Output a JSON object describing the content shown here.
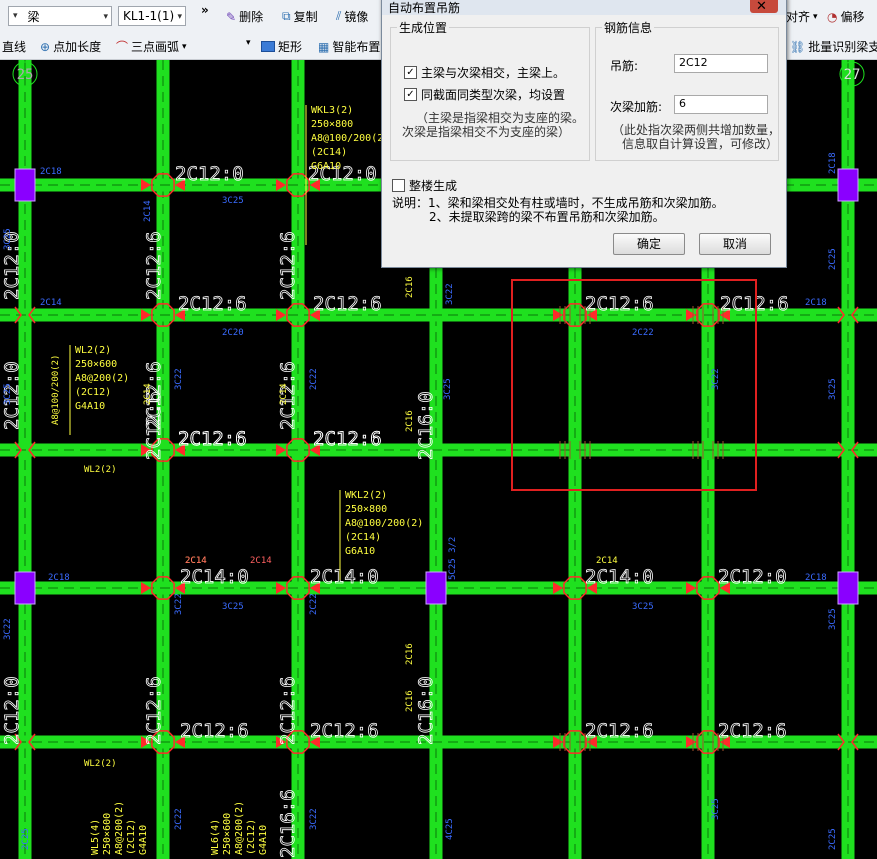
{
  "toolbar": {
    "component_type": "梁",
    "component_name": "KL1-1(1)",
    "more": "»",
    "delete": "删除",
    "copy": "复制",
    "mirror": "镜像",
    "align": "对齐",
    "offset": "偏移",
    "line": "直线",
    "point_length": "点加长度",
    "arc": "三点画弧",
    "rect": "矩形",
    "smart_layout": "智能布置",
    "batch_identify": "批量识别梁支"
  },
  "dialog": {
    "title": "自动布置吊筋",
    "close": "✕",
    "gen_position": {
      "legend": "生成位置",
      "opt1": "主梁与次梁相交，主梁上。",
      "opt2": "同截面同类型次梁，均设置",
      "note1": "（主梁是指梁相交为支座的梁。",
      "note2": "次梁是指梁相交不为支座的梁）"
    },
    "rebar_info": {
      "legend": "钢筋信息",
      "hanger_label": "吊筋:",
      "hanger_value": "2C12",
      "stirrup_label": "次梁加筋:",
      "stirrup_value": "6",
      "note1": "（此处指次梁两侧共增加数量，",
      "note2": "信息取自计算设置，可修改）"
    },
    "whole_floor": "整楼生成",
    "desc1": "说明：1、梁和梁相交处有柱或墙时，不生成吊筋和次梁加筋。",
    "desc2": "2、未提取梁跨的梁不布置吊筋和次梁加筋。",
    "ok": "确定",
    "cancel": "取消"
  },
  "cad": {
    "axis_left": "25",
    "axis_right": "27",
    "beam_labels": [
      "2C12:0",
      "2C12:0",
      "2C12:6",
      "2C12:6",
      "2C12:6",
      "2C12:6",
      "2C12:6",
      "2C12:6",
      "2C12:6",
      "2C12:6",
      "2C14:0",
      "2C14:0",
      "2C14:0",
      "2C12:0",
      "2C12:6",
      "2C12:6",
      "2C12:6",
      "2C12:6"
    ],
    "vertical_labels": [
      "2C12:0",
      "2C12:6",
      "2C12:6",
      "2C12:0",
      "2C12:6",
      "2C12:6",
      "2C12:6",
      "2C16:0",
      "2C12:0",
      "2C12:6",
      "2C12:6",
      "2C16:0",
      "2C16:6"
    ],
    "blue_labels": [
      "2C18",
      "3C25",
      "2C14",
      "2C18",
      "3C25",
      "2C14",
      "2C20",
      "3C22",
      "2C22",
      "3C25",
      "3C22",
      "2C22",
      "3C25",
      "2C18",
      "3C25",
      "3C22",
      "5C25 3/2",
      "3C25",
      "3C22",
      "2C22",
      "3C25",
      "2C25",
      "3C22",
      "3C25",
      "2C18",
      "4C25",
      "2C25",
      "2C22",
      "3C22",
      "3C25",
      "2C25",
      "2C18"
    ],
    "yellow_blocks": [
      [
        "WKL3(2)",
        "250×800",
        "A8@100/200(2)",
        "(2C14)",
        "G6A10"
      ],
      [
        "WL2(2)",
        "250×600",
        "A8@200(2)",
        "(2C12)",
        "G4A10"
      ],
      [
        "WKL2(2)",
        "250×800",
        "A8@100/200(2)",
        "(2C14)",
        "G6A10"
      ],
      [
        "WL5(4)",
        "250×600",
        "A8@200(2)",
        "(2C12)",
        "G4A10"
      ],
      [
        "WL6(4)",
        "250×600",
        "A8@200(2)",
        "(2C12)",
        "G4A10"
      ]
    ],
    "small_yellow": [
      "WL2(2)",
      "WL2(2)",
      "2C16",
      "2C16",
      "2C16",
      "2C16",
      "2C14",
      "2C14",
      "2C14",
      "2C14",
      "A8@100/200(2)"
    ],
    "red_small": [
      "2C14",
      "2C14"
    ],
    "colors": {
      "beam": "#1fe01f",
      "hanger": "#ff2a2a",
      "column": "#8a00ff",
      "text_blue": "#3a6bff",
      "text_yellow": "#ffff40",
      "selection": "#e02020"
    }
  }
}
